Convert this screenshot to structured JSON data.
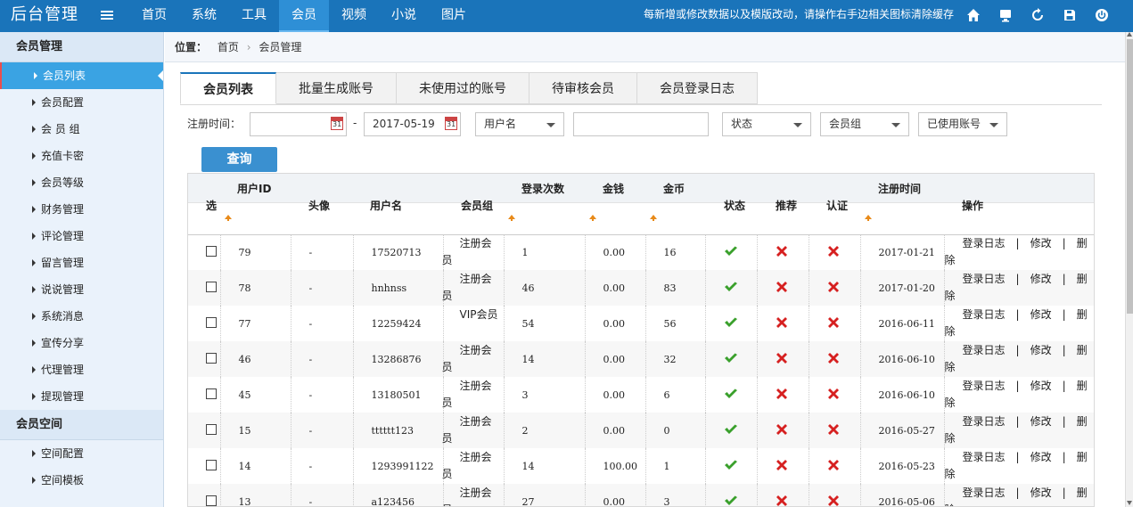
{
  "app": {
    "title": "后台管理"
  },
  "nav": [
    "首页",
    "系统",
    "工具",
    "会员",
    "视频",
    "小说",
    "图片"
  ],
  "nav_active": 3,
  "notice": "每新增或修改数据以及模版改动，请操作右手边相关图标清除缓存",
  "top_icons": [
    "home-icon",
    "monitor-icon",
    "refresh-icon",
    "save-icon",
    "power-icon"
  ],
  "sidebar": {
    "group1": "会员管理",
    "items1": [
      "会员列表",
      "会员配置",
      "会 员 组",
      "充值卡密",
      "会员等级",
      "财务管理",
      "评论管理",
      "留言管理",
      "说说管理",
      "系统消息",
      "宣传分享",
      "代理管理",
      "提现管理"
    ],
    "group2": "会员空间",
    "items2": [
      "空间配置",
      "空间模板"
    ]
  },
  "breadcrumb": {
    "label": "位置：",
    "home": "首页",
    "current": "会员管理"
  },
  "tabs": [
    "会员列表",
    "批量生成账号",
    "未使用过的账号",
    "待审核会员",
    "会员登录日志"
  ],
  "filters": {
    "reg_time_label": "注册时间：",
    "date_start": "",
    "date_dash": "-",
    "date_end": "2017-05-19",
    "field_select": "用户名",
    "keyword": "",
    "status_select": "状态",
    "group_select": "会员组",
    "used_select": "已使用账号",
    "query_button": "查询"
  },
  "table": {
    "headers": {
      "select": "选",
      "user_id": "用户ID",
      "avatar": "头像",
      "username": "用户名",
      "group": "会员组",
      "login_count": "登录次数",
      "money": "金钱",
      "coins": "金币",
      "status": "状态",
      "recommend": "推荐",
      "verify": "认证",
      "reg_time": "注册时间",
      "actions": "操作"
    },
    "actions": {
      "log": "登录日志",
      "sep": "|",
      "edit": "修改",
      "del1": "删",
      "del2": "除"
    },
    "rows": [
      {
        "id": "79",
        "avatar": "-",
        "username": "17520713",
        "group1": "注册会",
        "group2": "员",
        "logins": "1",
        "money": "0.00",
        "coins": "16",
        "date": "2017-01-21"
      },
      {
        "id": "78",
        "avatar": "-",
        "username": "hnhnss",
        "group1": "注册会",
        "group2": "员",
        "logins": "46",
        "money": "0.00",
        "coins": "83",
        "date": "2017-01-20"
      },
      {
        "id": "77",
        "avatar": "-",
        "username": "12259424",
        "group1": "VIP会员",
        "group2": "",
        "logins": "54",
        "money": "0.00",
        "coins": "56",
        "date": "2016-06-11"
      },
      {
        "id": "46",
        "avatar": "-",
        "username": "13286876",
        "group1": "注册会",
        "group2": "员",
        "logins": "14",
        "money": "0.00",
        "coins": "32",
        "date": "2016-06-10"
      },
      {
        "id": "45",
        "avatar": "-",
        "username": "13180501",
        "group1": "注册会",
        "group2": "员",
        "logins": "3",
        "money": "0.00",
        "coins": "6",
        "date": "2016-06-10"
      },
      {
        "id": "15",
        "avatar": "-",
        "username": "tttttt123",
        "group1": "注册会",
        "group2": "员",
        "logins": "2",
        "money": "0.00",
        "coins": "0",
        "date": "2016-05-27"
      },
      {
        "id": "14",
        "avatar": "-",
        "username": "1293991122",
        "group1": "注册会",
        "group2": "员",
        "logins": "14",
        "money": "100.00",
        "coins": "1",
        "date": "2016-05-23"
      },
      {
        "id": "13",
        "avatar": "-",
        "username": "a123456",
        "group1": "注册会",
        "group2": "员",
        "logins": "27",
        "money": "0.00",
        "coins": "3",
        "date": "2016-05-06"
      }
    ]
  },
  "colors": {
    "topbar": "#1a74ba",
    "active_side": "#3aa3e3",
    "tick": "#3aa02c",
    "cross": "#d62020",
    "sort_arrow": "#e88a1a"
  }
}
